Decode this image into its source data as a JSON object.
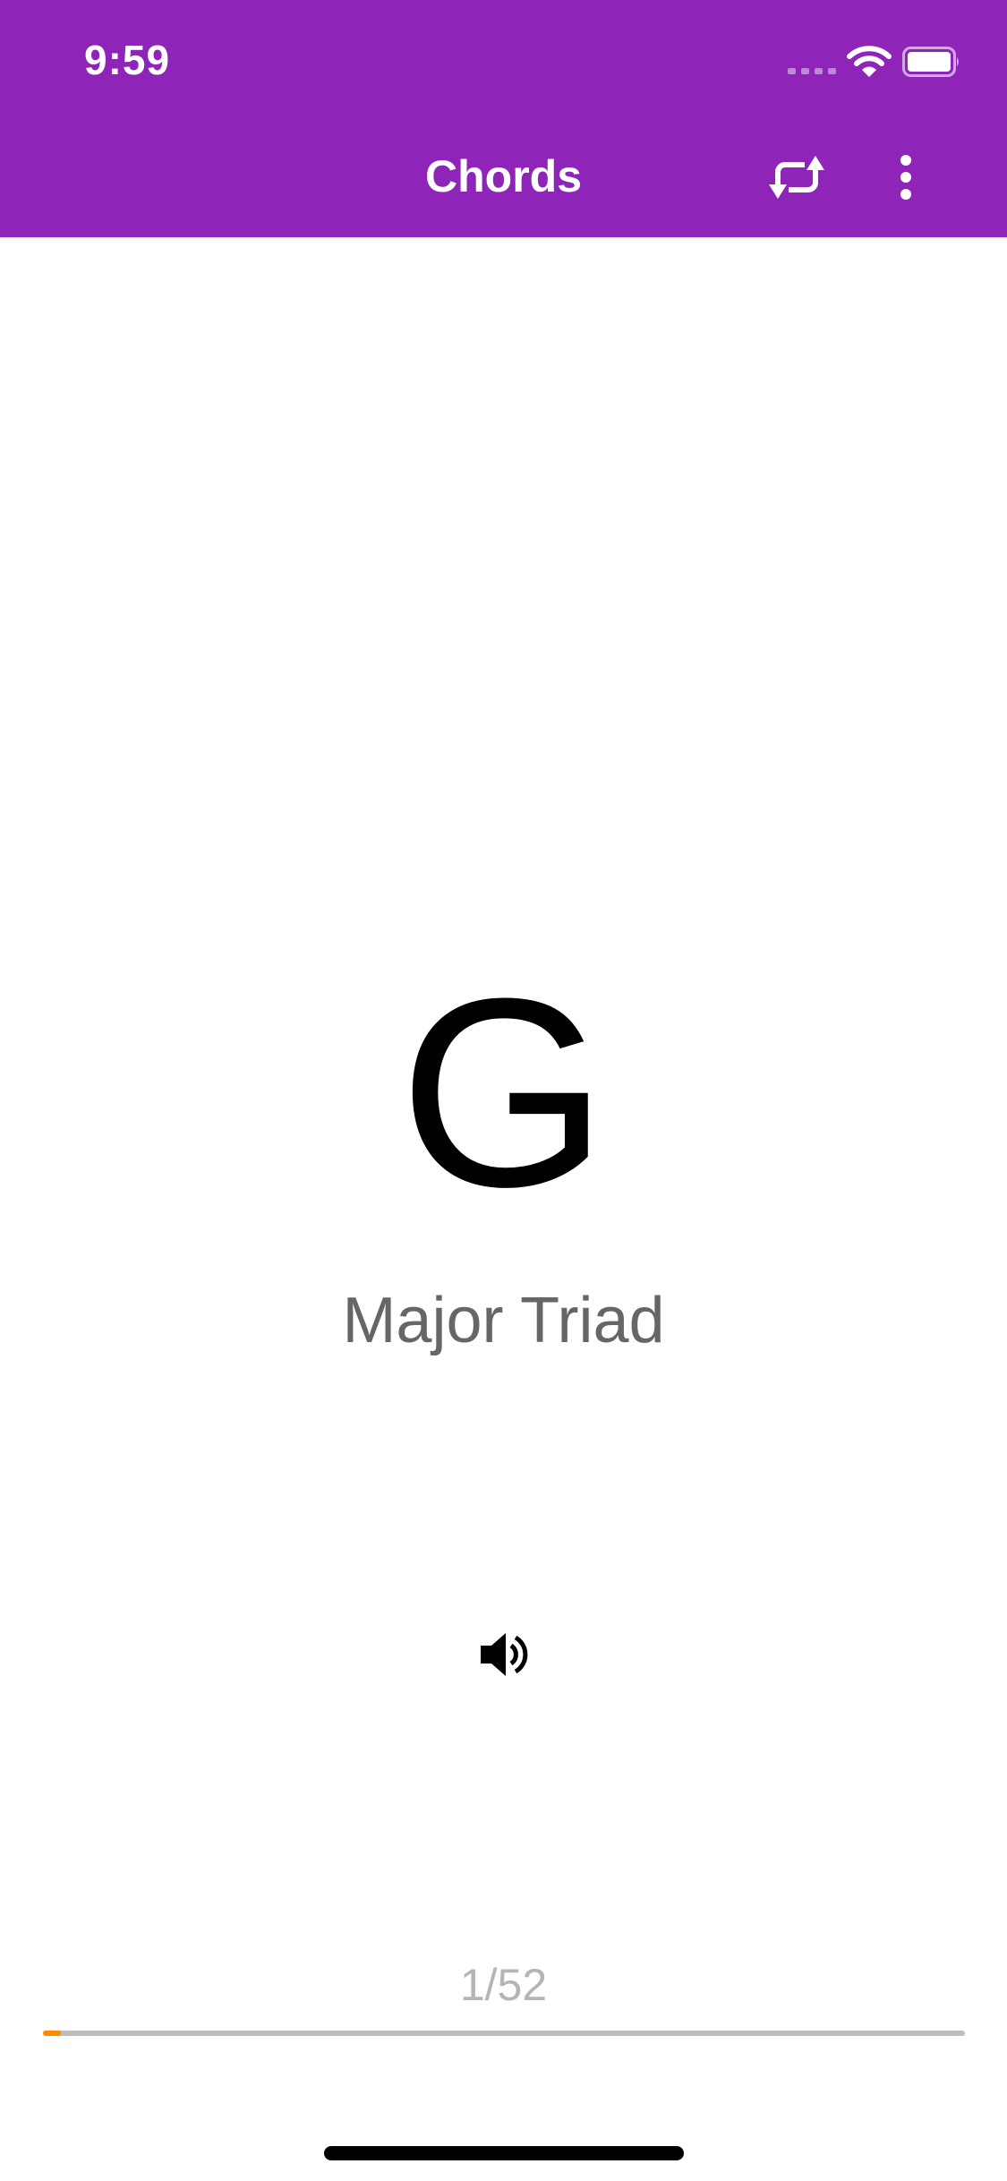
{
  "status_bar": {
    "time": "9:59"
  },
  "nav": {
    "title": "Chords",
    "repeat_icon": "repeat-icon",
    "more_icon": "more-vertical-icon"
  },
  "card": {
    "chord": "G",
    "type": "Major Triad",
    "sound_icon": "speaker-icon"
  },
  "progress": {
    "counter": "1/52",
    "current": 1,
    "total": 52
  },
  "colors": {
    "header": "#8e24b8",
    "progress_fill": "#ff8a00",
    "progress_track": "#bdbdbd"
  }
}
